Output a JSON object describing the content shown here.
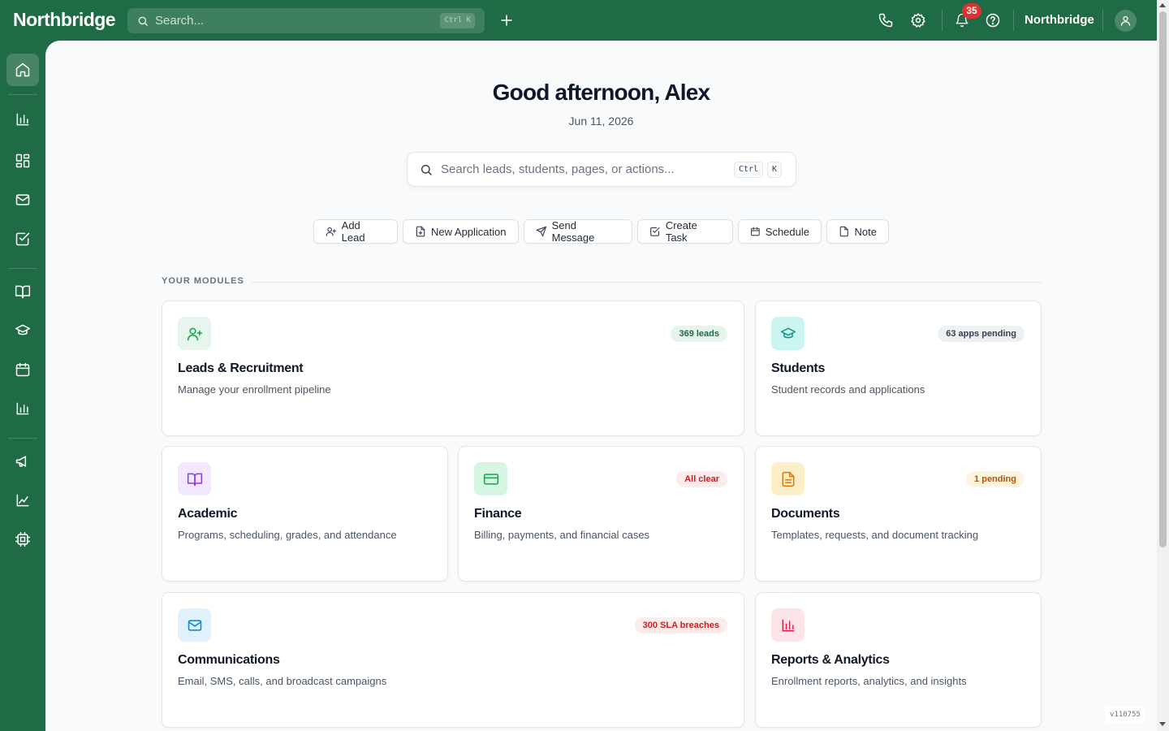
{
  "app": {
    "brand": "Northbridge",
    "org_name": "Northbridge",
    "version": "v110755"
  },
  "topbar": {
    "search_placeholder": "Search...",
    "shortcut": "Ctrl K",
    "notification_count": "35"
  },
  "sidebar": {
    "items": [
      {
        "icon": "home-icon",
        "active": true
      },
      {
        "icon": "bar-chart-icon"
      },
      {
        "icon": "dashboard-grid-icon"
      },
      {
        "icon": "mail-icon"
      },
      {
        "icon": "checkbox-icon"
      },
      {
        "icon": "book-icon"
      },
      {
        "icon": "graduation-cap-icon"
      },
      {
        "icon": "calendar-icon"
      },
      {
        "icon": "analytics-bar-icon"
      },
      {
        "icon": "megaphone-icon"
      },
      {
        "icon": "line-chart-icon"
      },
      {
        "icon": "cpu-chip-icon"
      }
    ]
  },
  "main": {
    "greeting": "Good afternoon, Alex",
    "date": "Jun 11, 2026",
    "search_placeholder": "Search leads, students, pages, or actions...",
    "shortcut_keys": [
      "Ctrl",
      "K"
    ],
    "quick_actions": [
      {
        "label": "Add Lead",
        "icon": "user-plus-icon"
      },
      {
        "label": "New Application",
        "icon": "file-plus-icon"
      },
      {
        "label": "Send Message",
        "icon": "send-icon"
      },
      {
        "label": "Create Task",
        "icon": "check-square-icon"
      },
      {
        "label": "Schedule",
        "icon": "calendar-icon"
      },
      {
        "label": "Note",
        "icon": "note-icon"
      }
    ],
    "section_label": "YOUR MODULES",
    "modules": [
      {
        "title": "Leads & Recruitment",
        "desc": "Manage your enrollment pipeline",
        "badge": "369 leads",
        "icon": "user-plus-icon",
        "color": "#16a34a",
        "tint": "#e8f5ee",
        "badge_bg": "#e7f3ec",
        "badge_fg": "#1f6b45"
      },
      {
        "title": "Students",
        "desc": "Student records and applications",
        "badge": "63 apps pending",
        "icon": "graduation-cap-icon",
        "color": "#0d9488",
        "tint": "#ccf5ef",
        "badge_bg": "#eef1f4",
        "badge_fg": "#374151"
      },
      {
        "title": "Academic",
        "desc": "Programs, scheduling, grades, and attendance",
        "badge": "",
        "icon": "book-open-icon",
        "color": "#9333ea",
        "tint": "#f3e8ff",
        "badge_bg": "",
        "badge_fg": ""
      },
      {
        "title": "Finance",
        "desc": "Billing, payments, and financial cases",
        "badge": "All clear",
        "icon": "credit-card-icon",
        "color": "#16a34a",
        "tint": "#d7f5e3",
        "badge_bg": "#fdecec",
        "badge_fg": "#c81e1e"
      },
      {
        "title": "Documents",
        "desc": "Templates, requests, and document tracking",
        "badge": "1 pending",
        "icon": "document-icon",
        "color": "#d97706",
        "tint": "#fdf0c8",
        "badge_bg": "#fdf5df",
        "badge_fg": "#b45309"
      },
      {
        "title": "Communications",
        "desc": "Email, SMS, calls, and broadcast campaigns",
        "badge": "300 SLA breaches",
        "icon": "mail-icon",
        "color": "#0284c7",
        "tint": "#e0f0fd",
        "badge_bg": "#fdecec",
        "badge_fg": "#c81e1e"
      },
      {
        "title": "Reports & Analytics",
        "desc": "Enrollment reports, analytics, and insights",
        "badge": "",
        "icon": "bar-chart-icon",
        "color": "#e11d48",
        "tint": "#fde4e8",
        "badge_bg": "",
        "badge_fg": ""
      }
    ]
  }
}
